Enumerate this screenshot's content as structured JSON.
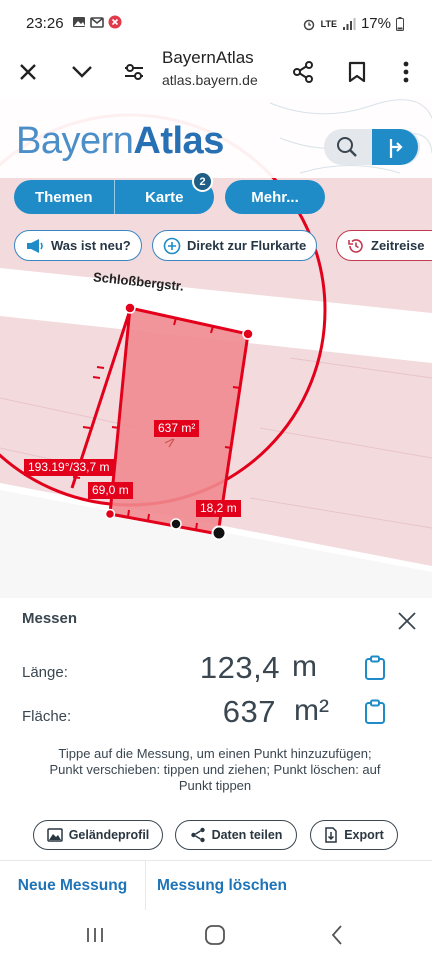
{
  "status": {
    "time": "23:26",
    "network": "LTE",
    "battery": "17%"
  },
  "browser": {
    "site_title": "BayernAtlas",
    "url": "atlas.bayern.de"
  },
  "app": {
    "logo_part1": "Bayern",
    "logo_part2": "Atlas",
    "nav_tabs": [
      "Themen",
      "Karte"
    ],
    "karte_badge": "2",
    "more_label": "Mehr...",
    "chips": [
      "Was ist neu?",
      "Direkt zur Flurkarte",
      "Zeitreise"
    ]
  },
  "map": {
    "street_name": "Schloßbergstr.",
    "area_label": "637 m²",
    "azimuth_label": "193.19°/33,7 m",
    "segment_label_1": "69,0 m",
    "segment_label_2": "18,2 m"
  },
  "measure": {
    "title": "Messen",
    "length_label": "Länge:",
    "length_value": "123,4",
    "length_unit": "m",
    "area_label": "Fläche:",
    "area_value": "637",
    "area_unit": "m²",
    "hint": "Tippe auf die Messung, um einen Punkt hinzuzufügen; Punkt verschieben: tippen und ziehen; Punkt löschen: auf Punkt tippen",
    "buttons": [
      "Geländeprofil",
      "Daten teilen",
      "Export"
    ],
    "new_measure": "Neue Messung",
    "delete_measure": "Messung löschen"
  },
  "colors": {
    "accent": "#1f8cc8",
    "measure_red": "#e3001b",
    "text_dark": "#3a4650"
  }
}
